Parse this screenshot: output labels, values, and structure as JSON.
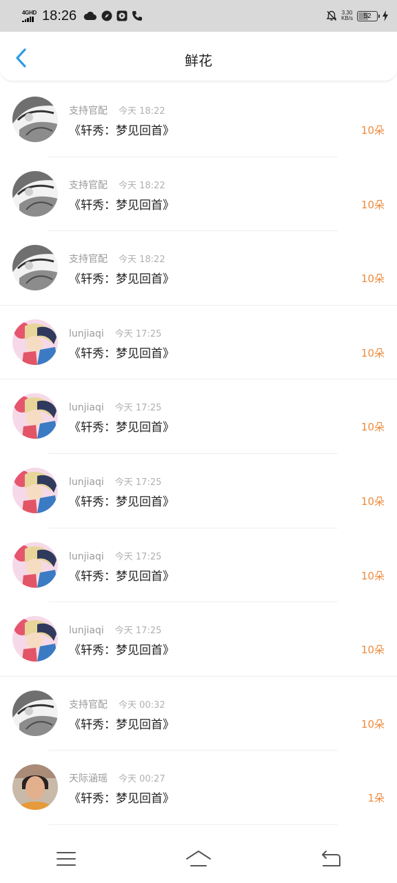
{
  "status_bar": {
    "network": "4GHD",
    "time": "18:26",
    "speed_value": "3.30",
    "speed_unit": "KB/s",
    "battery": "52",
    "battery_level": 0.52
  },
  "header": {
    "title": "鲜花"
  },
  "items": [
    {
      "user": "支持官配",
      "time": "今天 18:22",
      "gift": "《轩秀：梦见回首》",
      "count": "10朵",
      "avatar": "gray-anime"
    },
    {
      "user": "支持官配",
      "time": "今天 18:22",
      "gift": "《轩秀：梦见回首》",
      "count": "10朵",
      "avatar": "gray-anime"
    },
    {
      "user": "支持官配",
      "time": "今天 18:22",
      "gift": "《轩秀：梦见回首》",
      "count": "10朵",
      "avatar": "gray-anime"
    },
    {
      "user": "lunjiaqi",
      "time": "今天 17:25",
      "gift": "《轩秀：梦见回首》",
      "count": "10朵",
      "avatar": "pink-anime"
    },
    {
      "user": "lunjiaqi",
      "time": "今天 17:25",
      "gift": "《轩秀：梦见回首》",
      "count": "10朵",
      "avatar": "pink-anime"
    },
    {
      "user": "lunjiaqi",
      "time": "今天 17:25",
      "gift": "《轩秀：梦见回首》",
      "count": "10朵",
      "avatar": "pink-anime"
    },
    {
      "user": "lunjiaqi",
      "time": "今天 17:25",
      "gift": "《轩秀：梦见回首》",
      "count": "10朵",
      "avatar": "pink-anime"
    },
    {
      "user": "lunjiaqi",
      "time": "今天 17:25",
      "gift": "《轩秀：梦见回首》",
      "count": "10朵",
      "avatar": "pink-anime"
    },
    {
      "user": "支持官配",
      "time": "今天 00:32",
      "gift": "《轩秀：梦见回首》",
      "count": "10朵",
      "avatar": "gray-anime"
    },
    {
      "user": "天际涵瑶",
      "time": "今天 00:27",
      "gift": "《轩秀：梦见回首》",
      "count": "1朵",
      "avatar": "photo-person"
    }
  ],
  "icons": {
    "back": "chevron-left-icon",
    "menu": "menu-icon",
    "home": "home-icon",
    "return": "return-icon"
  },
  "colors": {
    "accent_blue": "#2f9be8",
    "count_orange": "#ef8a3c"
  }
}
